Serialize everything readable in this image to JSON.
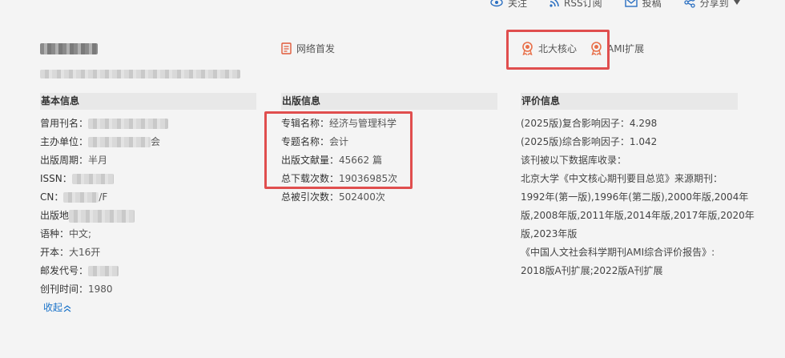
{
  "topbar": {
    "follow_label": "关注",
    "rss_label": "RSS订阅",
    "submit_label": "投稿",
    "share_label": "分享到"
  },
  "badges": {
    "network_first": "网络首发",
    "pku_core": "北大核心",
    "ami": "AMI扩展"
  },
  "sections": {
    "basic": "基本信息",
    "publish": "出版信息",
    "eval": "评价信息"
  },
  "basic": {
    "former_name_label": "曾用刊名：",
    "sponsor_label": "主办单位：",
    "sponsor_suffix": "会",
    "cycle_label": "出版周期：",
    "cycle_value": "半月",
    "issn_label": "ISSN：",
    "cn_label": "CN：",
    "cn_suffix": "/F",
    "place_label": "出版地",
    "language_label": "语种：",
    "language_value": "中文;",
    "format_label": "开本：",
    "format_value": "大16开",
    "postcode_label": "邮发代号：",
    "founded_label": "创刊时间：",
    "founded_value": "1980",
    "collapse_label": "收起"
  },
  "publish": {
    "album_label": "专辑名称：",
    "album_value": "经济与管理科学",
    "topic_label": "专题名称：",
    "topic_value": "会计",
    "docs_label": "出版文献量：",
    "docs_value": "45662 篇",
    "downloads_label": "总下载次数：",
    "downloads_value": "19036985次",
    "citations_label": "总被引次数：",
    "citations_value": "502400次"
  },
  "eval": {
    "line1": "(2025版)复合影响因子：4.298",
    "line2": "(2025版)综合影响因子：1.042",
    "line3": "该刊被以下数据库收录：",
    "line4": "北京大学《中文核心期刊要目总览》来源期刊：",
    "line5": "1992年(第一版),1996年(第二版),2000年版,2004年",
    "line6": "版,2008年版,2011年版,2014年版,2017年版,2020年",
    "line7": "版,2023年版",
    "line8": "《中国人文社会科学期刊AMI综合评价报告》:",
    "line9": "2018版A刊扩展;2022版A刊扩展"
  },
  "colors": {
    "highlight_box": "#e04e4e",
    "badge_orange": "#e8704a",
    "link_blue": "#1a73c9"
  }
}
